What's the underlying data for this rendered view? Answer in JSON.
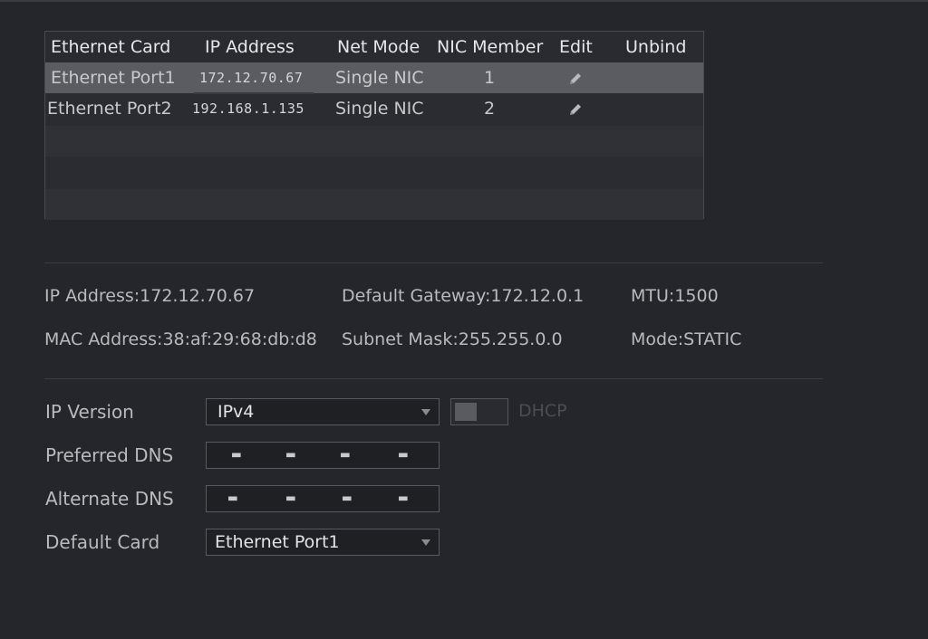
{
  "table": {
    "headers": [
      "Ethernet Card",
      "IP Address",
      "Net Mode",
      "NIC Member",
      "Edit",
      "Unbind"
    ],
    "rows": [
      {
        "card": "Ethernet Port1",
        "ip": "172.12.70.67",
        "mode": "Single NIC",
        "member": "1"
      },
      {
        "card": "Ethernet Port2",
        "ip": "192.168.1.135",
        "mode": "Single NIC",
        "member": "2"
      }
    ]
  },
  "info": {
    "ip_label": "IP Address:",
    "ip_value": "172.12.70.67",
    "gateway_label": "Default Gateway:",
    "gateway_value": "172.12.0.1",
    "mtu_label": "MTU:",
    "mtu_value": "1500",
    "mac_label": "MAC Address:",
    "mac_value": "38:af:29:68:db:d8",
    "mask_label": "Subnet Mask:",
    "mask_value": "255.255.0.0",
    "mode_label": "Mode:",
    "mode_value": "STATIC"
  },
  "form": {
    "ip_version_label": "IP Version",
    "ip_version_value": "IPv4",
    "dhcp_label": "DHCP",
    "preferred_dns_label": "Preferred DNS",
    "alternate_dns_label": "Alternate DNS",
    "default_card_label": "Default Card",
    "default_card_value": "Ethernet Port1"
  },
  "icons": {
    "edit": "pencil-icon",
    "dropdown": "chevron-down-icon"
  },
  "colors": {
    "background": "#25262b",
    "selected_row": "#5b5c61",
    "text": "#c8c9cc"
  }
}
